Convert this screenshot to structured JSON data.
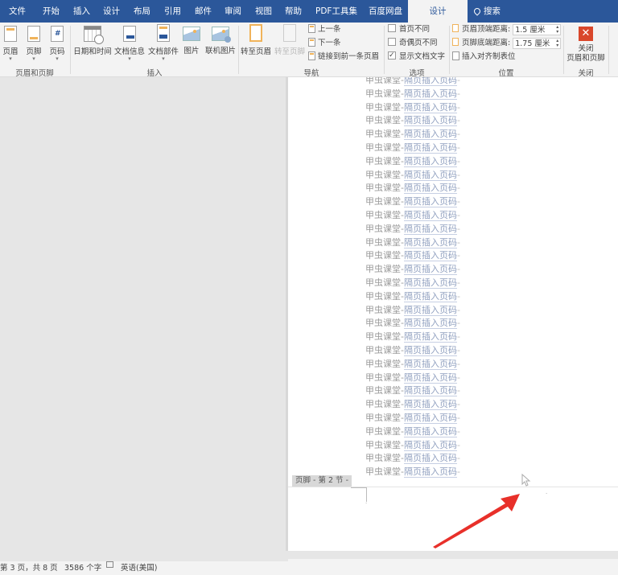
{
  "tabs": [
    {
      "label": "文件"
    },
    {
      "label": "开始"
    },
    {
      "label": "插入"
    },
    {
      "label": "设计"
    },
    {
      "label": "布局"
    },
    {
      "label": "引用"
    },
    {
      "label": "邮件"
    },
    {
      "label": "审阅"
    },
    {
      "label": "视图"
    },
    {
      "label": "帮助"
    },
    {
      "label": "PDF工具集"
    },
    {
      "label": "百度网盘"
    },
    {
      "label": "设计",
      "active": true
    },
    {
      "label": "搜索",
      "icon": "lightbulb-search-icon"
    }
  ],
  "ribbon": {
    "header_footer_group": {
      "label": "页眉和页脚",
      "buttons": [
        {
          "label": "页眉",
          "icon": "header-icon"
        },
        {
          "label": "页脚",
          "icon": "footer-icon"
        },
        {
          "label": "页码",
          "icon": "page-number-icon"
        }
      ]
    },
    "insert_group": {
      "label": "插入",
      "buttons": [
        {
          "label": "日期和时间",
          "icon": "date-time-icon"
        },
        {
          "label": "文档信息",
          "icon": "document-info-icon"
        },
        {
          "label": "文档部件",
          "icon": "quick-parts-icon"
        },
        {
          "label": "图片",
          "icon": "picture-icon"
        },
        {
          "label": "联机图片",
          "icon": "online-picture-icon"
        }
      ]
    },
    "navigation_group": {
      "label": "导航",
      "goto_header": "转至页眉",
      "goto_footer": "转至页脚",
      "previous": "上一条",
      "next": "下一条",
      "link_to_previous": "链接到前一条页眉"
    },
    "options_group": {
      "label": "选项",
      "different_first_page": {
        "label": "首页不同",
        "checked": false
      },
      "different_odd_even": {
        "label": "奇偶页不同",
        "checked": false
      },
      "show_document_text": {
        "label": "显示文档文字",
        "checked": true
      }
    },
    "position_group": {
      "label": "位置",
      "header_from_top_label": "页眉顶端距离:",
      "header_from_top_value": "1.5 厘米",
      "footer_from_bottom_label": "页脚底端距离:",
      "footer_from_bottom_value": "1.75 厘米",
      "insert_alignment_tab": "插入对齐制表位"
    },
    "close_group": {
      "label": "关闭",
      "button_line1": "关闭",
      "button_line2": "页眉和页脚"
    }
  },
  "document": {
    "line_prefix": "甲虫课堂-",
    "line_link": "隔页插入页码",
    "line_mark": "-",
    "line_count": 30,
    "footer_tag": "页脚 - 第 2 节 -"
  },
  "status": {
    "page": "第 3 页，共 8 页",
    "words": "3586 个字",
    "language": "英语(美国)"
  },
  "colors": {
    "accent": "#2b579a",
    "annotation_arrow": "#e8302a",
    "close_button": "#d9472b"
  }
}
